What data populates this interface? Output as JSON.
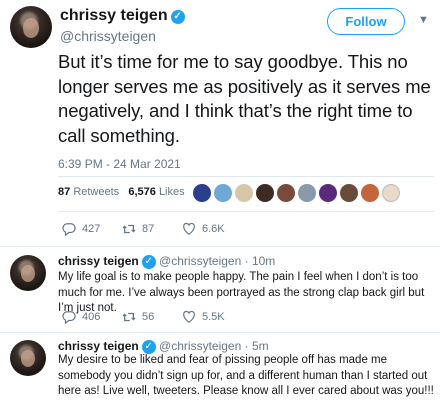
{
  "main": {
    "name": "chrissy teigen",
    "handle": "@chrissyteigen",
    "follow_label": "Follow",
    "text": "But it’s time for me to say goodbye. This no longer serves me as positively as it serves me negatively, and I think that’s the right time to call something.",
    "timestamp": "6:39 PM - 24 Mar 2021",
    "retweets_count": "87",
    "retweets_label": "Retweets",
    "likes_count": "6,576",
    "likes_label": "Likes",
    "replies": "427",
    "retweets": "87",
    "likes": "6.6K"
  },
  "replies": [
    {
      "name": "chrissy teigen",
      "handle": "@chrissyteigen",
      "time": "· 10m",
      "text": "My life goal is to make people happy. The pain I feel when I don’t is too much for me. I’ve always been portrayed as the strong clap back girl but I’m just not.",
      "replies": "406",
      "retweets": "56",
      "likes": "5.5K"
    },
    {
      "name": "chrissy teigen",
      "handle": "@chrissyteigen",
      "time": "· 5m",
      "text": "My desire to be liked and fear of pissing people off has made me somebody you didn’t sign up for, and a different human than I started out here as! Live well, tweeters. Please know all I ever cared about was you!!!"
    }
  ],
  "colors": {
    "accent": "#1da1f2",
    "muted": "#657786",
    "text": "#14171a",
    "divider": "#e1e8ed"
  }
}
